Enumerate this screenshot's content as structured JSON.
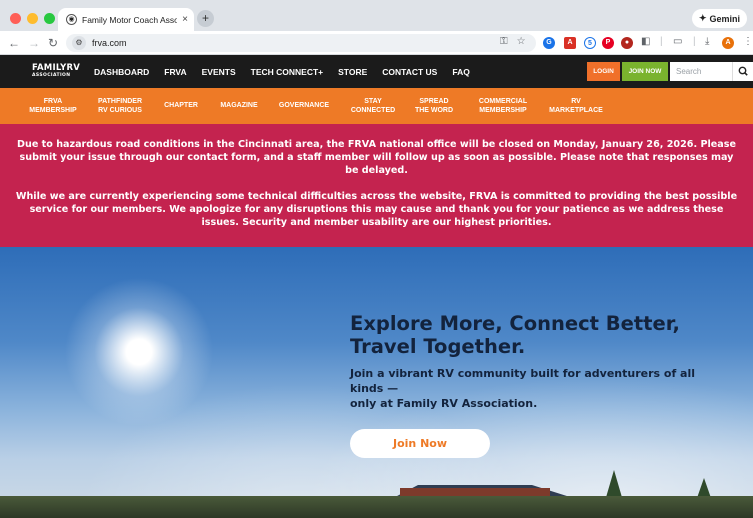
{
  "browser": {
    "tab_title": "Family Motor Coach Associati",
    "url": "frva.com",
    "gemini_label": "Gemini"
  },
  "nav": {
    "logo_line1": "FAMILYRV",
    "logo_line2": "ASSOCIATION",
    "links": [
      "DASHBOARD",
      "FRVA",
      "EVENTS",
      "TECH CONNECT+",
      "STORE",
      "CONTACT US",
      "FAQ"
    ],
    "login_label": "LOGIN",
    "join_label": "JOIN NOW",
    "search_placeholder": "Search"
  },
  "subnav": {
    "items": [
      "FRVA\nMEMBERSHIP",
      "PATHFINDER\nRV CURIOUS",
      "CHAPTER",
      "MAGAZINE",
      "GOVERNANCE",
      "STAY\nCONNECTED",
      "SPREAD\nTHE WORD",
      "COMMERCIAL\nMEMBERSHIP",
      "RV\nMARKETPLACE"
    ]
  },
  "alert": {
    "p1": "Due to hazardous road conditions in the Cincinnati area, the FRVA national office will be closed on Monday, January 26, 2026. Please submit your issue through our contact form, and a staff member will follow up as soon as possible. Please note that responses may be delayed.",
    "p2": "While we are currently experiencing some technical difficulties across the website, FRVA is committed to providing the best possible service for our members. We apologize for any disruptions this may cause and thank you for your patience as we address these issues. Security and member usability are our highest priorities."
  },
  "hero": {
    "title": "Explore More, Connect Better, Travel Together.",
    "subtitle_line1": "Join a vibrant RV community built for adventurers of all kinds —",
    "subtitle_line2": "only at Family RV Association.",
    "cta_label": "Join Now"
  },
  "colors": {
    "nav_bg": "#1b1b1b",
    "orange": "#ee7a26",
    "green": "#7ab32e",
    "alert_bg": "#c4234f",
    "hero_text": "#13233d"
  }
}
